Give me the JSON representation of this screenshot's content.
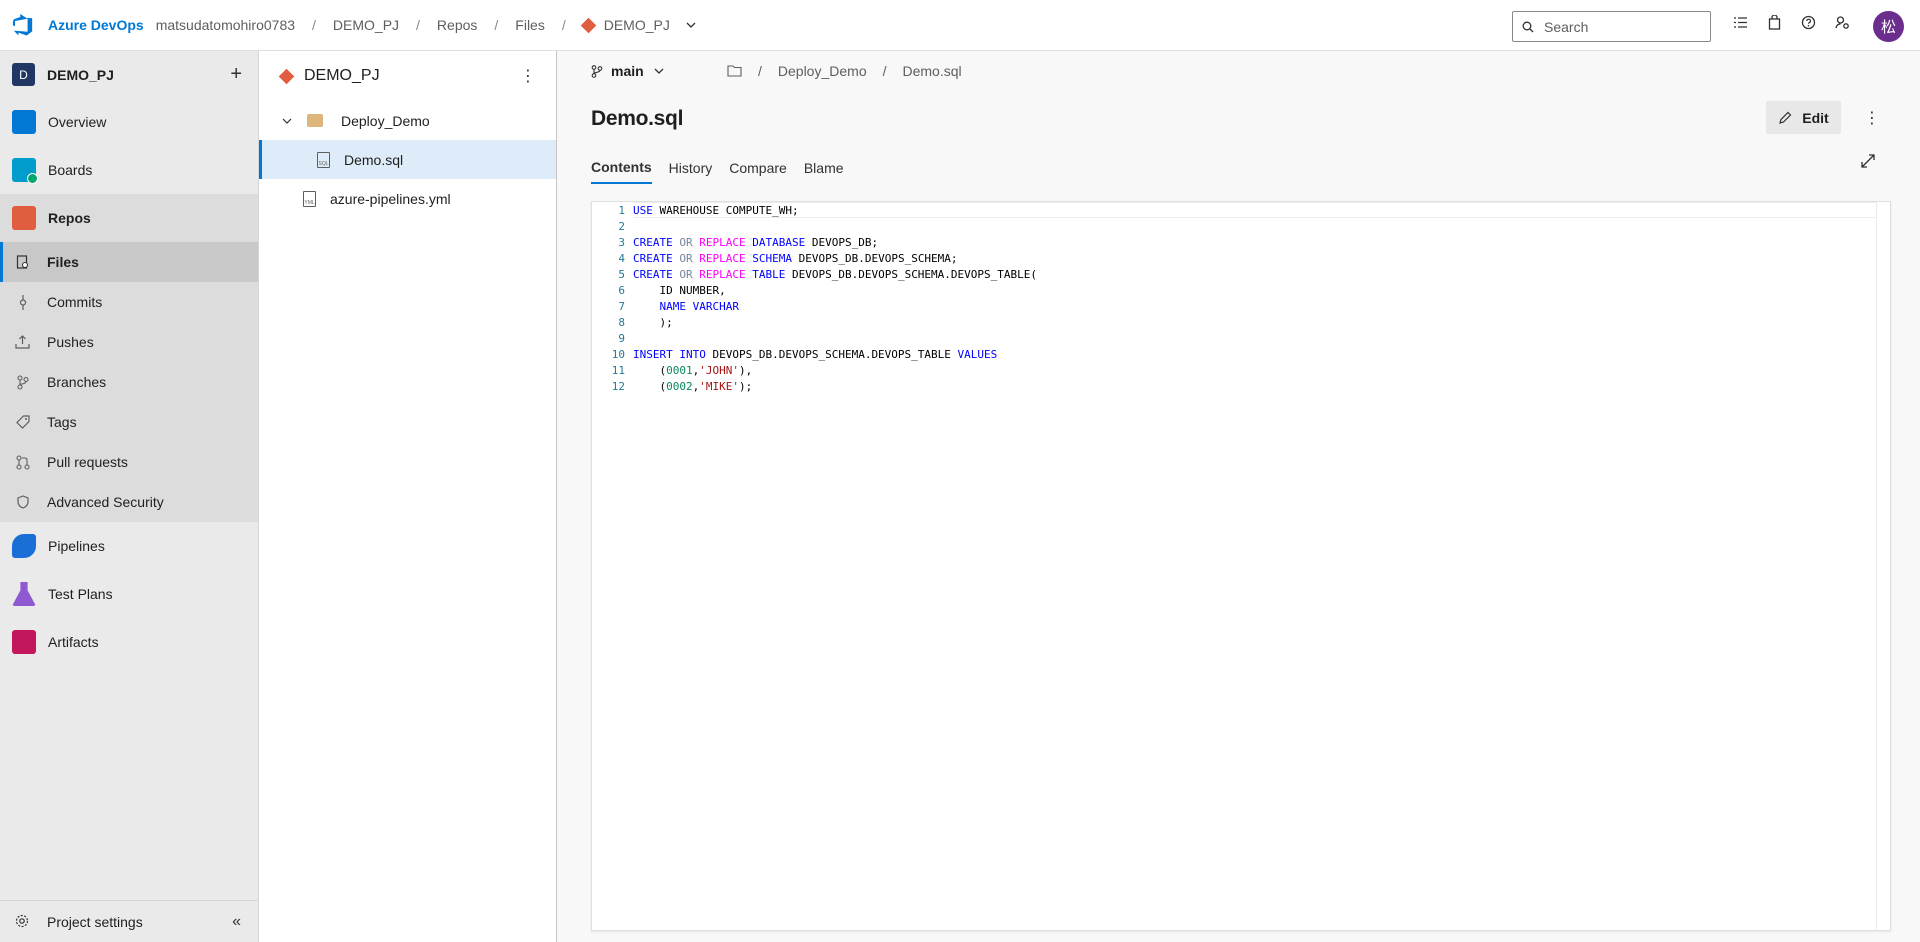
{
  "header": {
    "brand": "Azure DevOps",
    "org": "matsudatomohiro0783",
    "project": "DEMO_PJ",
    "section": "Repos",
    "page": "Files",
    "repo": "DEMO_PJ",
    "search_placeholder": "Search",
    "avatar_initial": "松"
  },
  "sidebar": {
    "project_initial": "D",
    "project_name": "DEMO_PJ",
    "items": [
      {
        "label": "Overview",
        "icon": "overview-icon",
        "color": "#0078d4"
      },
      {
        "label": "Boards",
        "icon": "boards-icon",
        "color": "#009ccc"
      },
      {
        "label": "Repos",
        "icon": "repos-icon",
        "color": "#e05d3f"
      }
    ],
    "sub_items": [
      {
        "label": "Files",
        "icon": "file-icon"
      },
      {
        "label": "Commits",
        "icon": "commit-icon"
      },
      {
        "label": "Pushes",
        "icon": "push-icon"
      },
      {
        "label": "Branches",
        "icon": "branch-icon"
      },
      {
        "label": "Tags",
        "icon": "tag-icon"
      },
      {
        "label": "Pull requests",
        "icon": "pull-request-icon"
      },
      {
        "label": "Advanced Security",
        "icon": "shield-icon"
      }
    ],
    "more_items": [
      {
        "label": "Pipelines",
        "icon": "pipelines-icon",
        "color": "#1a6fd6"
      },
      {
        "label": "Test Plans",
        "icon": "test-plans-icon",
        "color": "#8f5ad1"
      },
      {
        "label": "Artifacts",
        "icon": "artifacts-icon",
        "color": "#c2185b"
      }
    ],
    "settings_label": "Project settings"
  },
  "tree": {
    "repo_name": "DEMO_PJ",
    "folder": "Deploy_Demo",
    "file_selected": "Demo.sql",
    "file_other": "azure-pipelines.yml"
  },
  "main": {
    "branch": "main",
    "path": [
      "Deploy_Demo",
      "Demo.sql"
    ],
    "file_title": "Demo.sql",
    "edit_label": "Edit",
    "tabs": [
      "Contents",
      "History",
      "Compare",
      "Blame"
    ],
    "code_lines": [
      "1",
      "2",
      "3",
      "4",
      "5",
      "6",
      "7",
      "8",
      "9",
      "10",
      "11",
      "12"
    ]
  }
}
